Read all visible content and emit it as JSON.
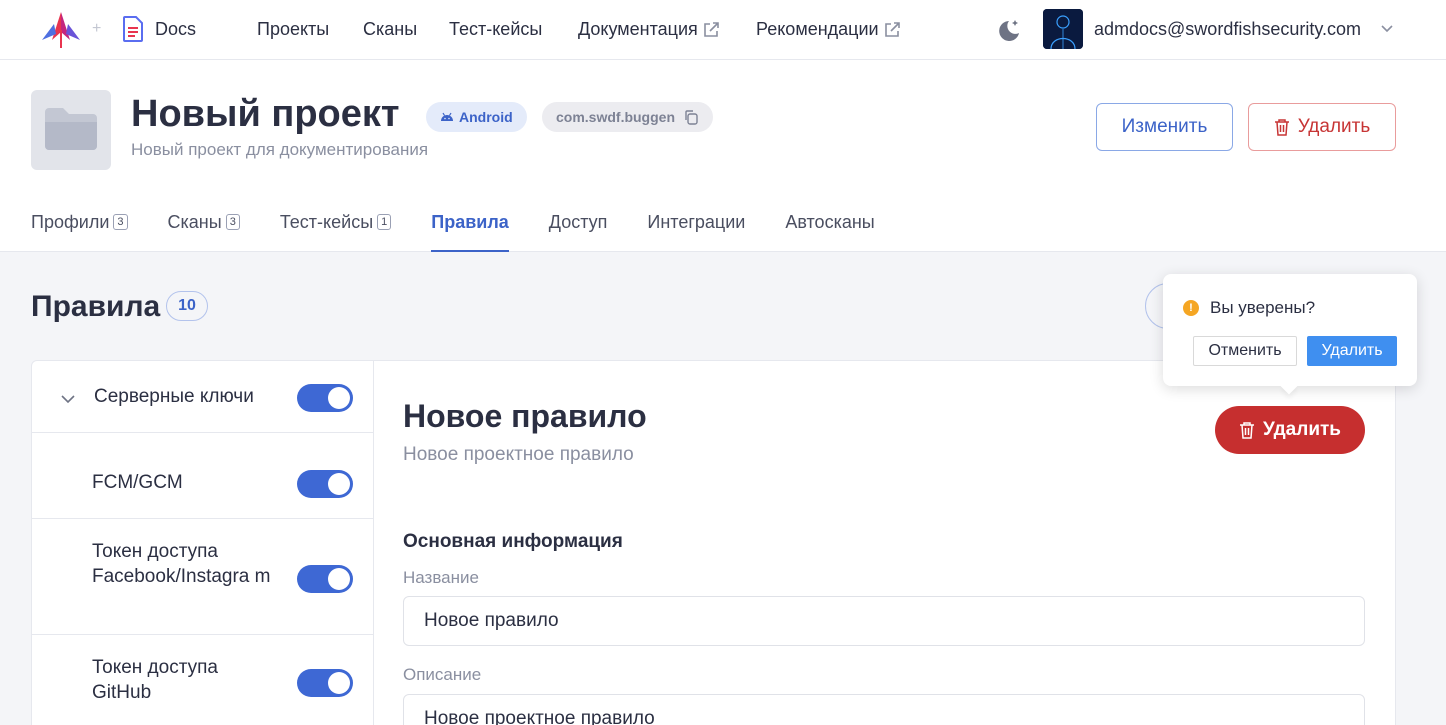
{
  "topbar": {
    "docs_label": "Docs",
    "nav": [
      {
        "label": "Проекты",
        "external": false
      },
      {
        "label": "Сканы",
        "external": false
      },
      {
        "label": "Тест-кейсы",
        "external": false
      },
      {
        "label": "Документация",
        "external": true
      },
      {
        "label": "Рекомендации",
        "external": true
      }
    ],
    "user_email": "admdocs@swordfishsecurity.com"
  },
  "project": {
    "title": "Новый проект",
    "platform_badge": "Android",
    "package_badge": "com.swdf.buggen",
    "description": "Новый проект для документирования",
    "edit_label": "Изменить",
    "delete_label": "Удалить"
  },
  "tabs": [
    {
      "label": "Профили",
      "count": "3",
      "active": false
    },
    {
      "label": "Сканы",
      "count": "3",
      "active": false
    },
    {
      "label": "Тест-кейсы",
      "count": "1",
      "active": false
    },
    {
      "label": "Правила",
      "count": "",
      "active": true
    },
    {
      "label": "Доступ",
      "count": "",
      "active": false
    },
    {
      "label": "Интеграции",
      "count": "",
      "active": false
    },
    {
      "label": "Автосканы",
      "count": "",
      "active": false
    }
  ],
  "rules": {
    "title": "Правила",
    "count": "10",
    "groups": [
      {
        "label": "Серверные ключи",
        "enabled": true,
        "expanded": true
      }
    ],
    "items": [
      {
        "label": "FCM/GCM",
        "enabled": true
      },
      {
        "label": "Токен доступа Facebook/Instagra m",
        "enabled": true
      },
      {
        "label": "Токен доступа GitHub",
        "enabled": true
      }
    ]
  },
  "rule_detail": {
    "title": "Новое правило",
    "subtitle": "Новое проектное правило",
    "delete_label": "Удалить",
    "section_label": "Основная информация",
    "name_label": "Название",
    "name_value": "Новое правило",
    "description_label": "Описание",
    "description_value": "Новое проектное правило"
  },
  "confirm_popover": {
    "question": "Вы уверены?",
    "cancel_label": "Отменить",
    "ok_label": "Удалить"
  },
  "colors": {
    "accent": "#3c63c8",
    "danger": "#c62f2f",
    "toggle_on": "#3e68d4",
    "popover_ok": "#3f8ff0",
    "warning": "#f5a623"
  }
}
